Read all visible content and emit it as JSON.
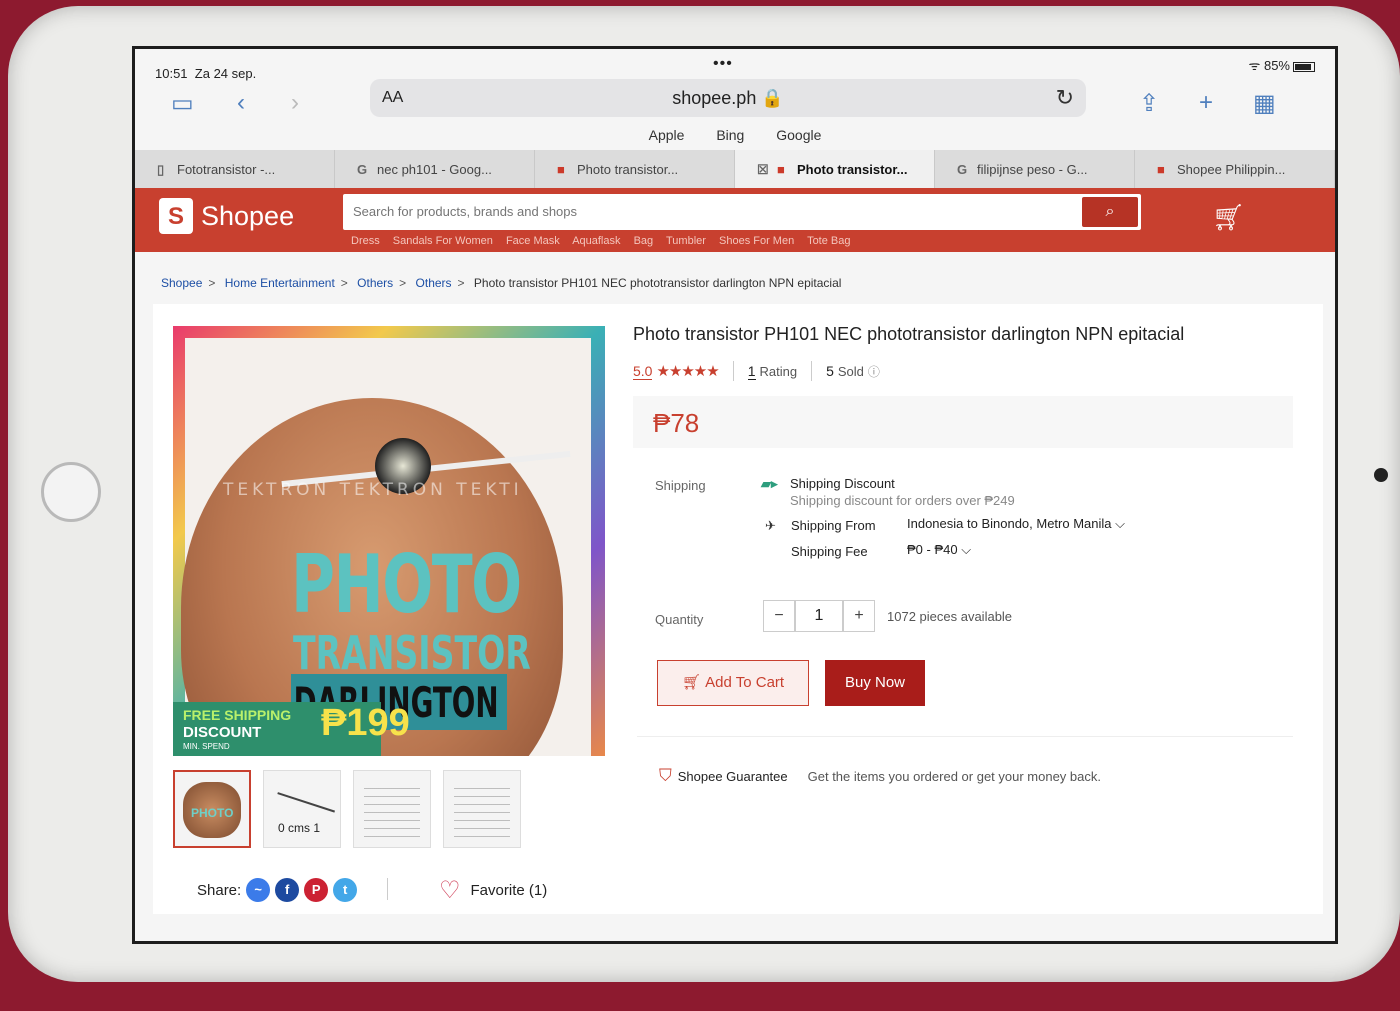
{
  "status_bar": {
    "time": "10:51",
    "date": "Za 24 sep.",
    "battery": "85%"
  },
  "browser": {
    "aa_label": "AA",
    "url": "shopee.ph 🔒",
    "favorites": [
      "Apple",
      "Bing",
      "Google"
    ],
    "tabs": [
      {
        "label": "Fototransistor -...",
        "icon": "page-icon"
      },
      {
        "label": "nec ph101 - Goog...",
        "icon": "google-icon"
      },
      {
        "label": "Photo transistor...",
        "icon": "shopee-icon"
      },
      {
        "label": "Photo transistor...",
        "icon": "shopee-icon",
        "active": true
      },
      {
        "label": "filipijnse peso - G...",
        "icon": "google-icon"
      },
      {
        "label": "Shopee Philippin...",
        "icon": "shopee-icon"
      }
    ]
  },
  "shopee": {
    "logo_text": "Shopee",
    "search_placeholder": "Search for products, brands and shops",
    "suggestions": [
      "Dress",
      "Sandals For Women",
      "Face Mask",
      "Aquaflask",
      "Bag",
      "Tumbler",
      "Shoes For Men",
      "Tote Bag"
    ],
    "accent_color": "#c8402f"
  },
  "breadcrumb": [
    "Shopee",
    "Home Entertainment",
    "Others",
    "Others",
    "Photo transistor PH101 NEC phototransistor darlington NPN epitacial"
  ],
  "product": {
    "title": "Photo transistor PH101 NEC phototransistor darlington NPN epitacial",
    "rating": "5.0",
    "stars": "★★★★★",
    "rating_count": "1",
    "rating_label": "Rating",
    "sold_count": "5",
    "sold_label": "Sold",
    "price": "₱78",
    "image": {
      "watermark": "TEKTRON TEKTRON TEKTI",
      "line1": "PHOTO",
      "line2": "TRANSISTOR",
      "line3": "DARLINGTON",
      "promo_free": "FREE SHIPPING",
      "promo_discount": "DISCOUNT",
      "promo_min": "MIN. SPEND",
      "promo_amount": "₱199"
    },
    "thumb_text": "PHOTO",
    "thumb_cms": "0 cms 1"
  },
  "shipping": {
    "label": "Shipping",
    "discount_title": "Shipping Discount",
    "discount_sub": "Shipping discount for orders over ₱249",
    "from_label": "Shipping From",
    "from_value": "Indonesia  to  Binondo, Metro Manila",
    "fee_label": "Shipping Fee",
    "fee_value": "₱0 - ₱40"
  },
  "quantity": {
    "label": "Quantity",
    "value": "1",
    "minus": "−",
    "plus": "+",
    "available": "1072 pieces available"
  },
  "buttons": {
    "add_to_cart": "Add To Cart",
    "buy_now": "Buy Now"
  },
  "guarantee": {
    "title": "Shopee Guarantee",
    "text": "Get the items you ordered or get your money back."
  },
  "share": {
    "label": "Share:",
    "favorite": "Favorite (1)"
  }
}
